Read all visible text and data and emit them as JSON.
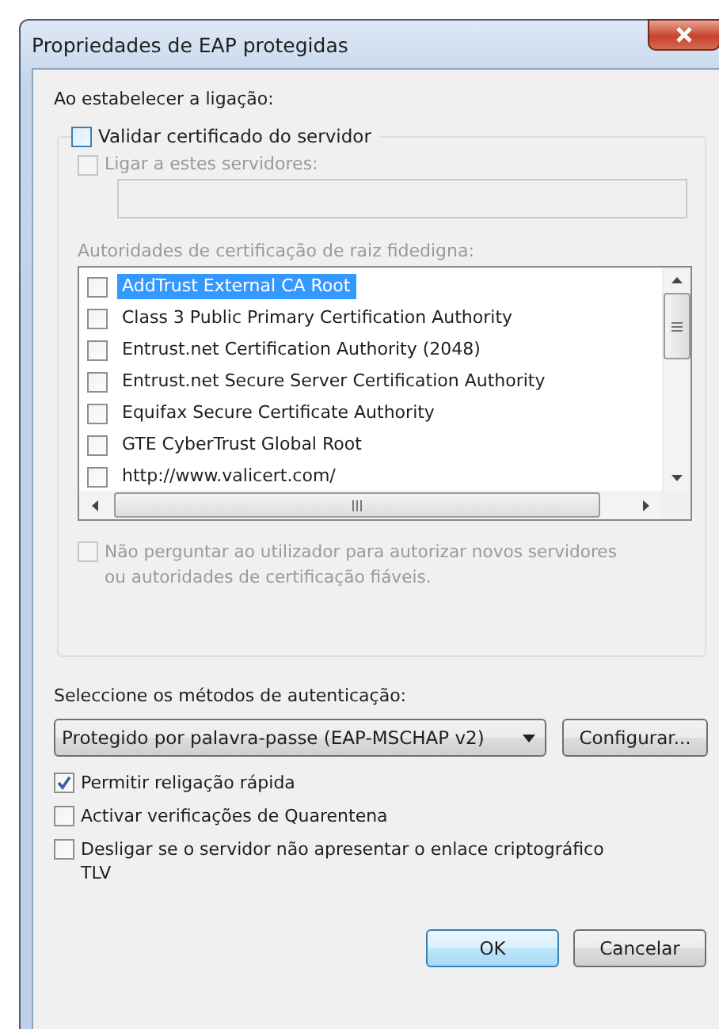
{
  "window": {
    "title": "Propriedades de EAP protegidas"
  },
  "connection": {
    "label": "Ao estabelecer a ligação:",
    "validate": {
      "label": "Validar certificado do servidor",
      "checked": false,
      "disabled": false
    },
    "connect": {
      "label": "Ligar a estes servidores:",
      "checked": false,
      "disabled": true
    },
    "servers_field": {
      "disabled": true
    },
    "roots_label": "Autoridades de certificação de raiz fidedigna:",
    "roots": [
      {
        "name": "AddTrust External CA Root",
        "checked": false,
        "selected": true
      },
      {
        "name": "Class 3 Public Primary Certification Authority",
        "checked": false,
        "selected": false
      },
      {
        "name": "Entrust.net Certification Authority (2048)",
        "checked": false,
        "selected": false
      },
      {
        "name": "Entrust.net Secure Server Certification Authority",
        "checked": false,
        "selected": false
      },
      {
        "name": "Equifax Secure Certificate Authority",
        "checked": false,
        "selected": false
      },
      {
        "name": "GTE CyberTrust Global Root",
        "checked": false,
        "selected": false
      },
      {
        "name": "http://www.valicert.com/",
        "checked": false,
        "selected": false
      }
    ],
    "no_prompt": {
      "label": "Não perguntar ao utilizador para autorizar novos servidores ou autoridades de certificação fiáveis.",
      "checked": false,
      "disabled": true
    }
  },
  "auth": {
    "label": "Seleccione os métodos de autenticação:",
    "method": "Protegido por palavra-passe (EAP-MSCHAP v2)",
    "configure": "Configurar...",
    "options": [
      {
        "label": "Permitir religação rápida",
        "checked": true,
        "disabled": false
      },
      {
        "label": "Activar verificações de Quarentena",
        "checked": false,
        "disabled": false
      },
      {
        "label": "Desligar se o servidor não apresentar o enlace criptográfico TLV",
        "checked": false,
        "disabled": false
      }
    ]
  },
  "buttons": [
    {
      "label": "OK",
      "default": true
    },
    {
      "label": "Cancelar",
      "default": false
    }
  ]
}
